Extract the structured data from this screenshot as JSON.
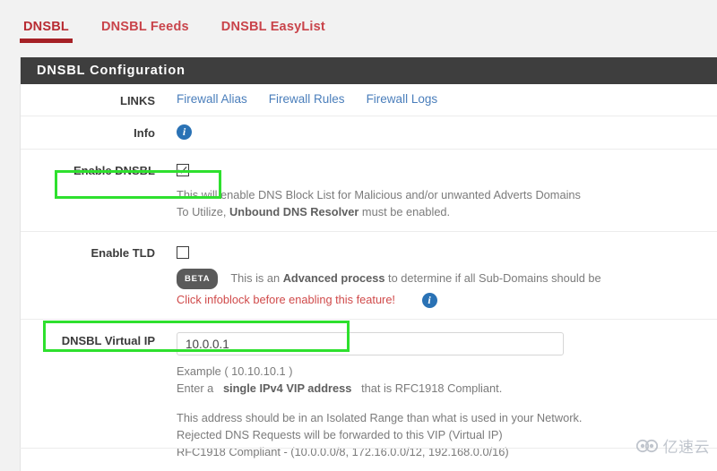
{
  "tabs": [
    {
      "label": "DNSBL",
      "active": true
    },
    {
      "label": "DNSBL Feeds",
      "active": false
    },
    {
      "label": "DNSBL EasyList",
      "active": false
    }
  ],
  "panel": {
    "title": "DNSBL Configuration"
  },
  "rows": {
    "links": {
      "label": "LINKS",
      "items": [
        {
          "label": "Firewall Alias"
        },
        {
          "label": "Firewall Rules"
        },
        {
          "label": "Firewall Logs"
        }
      ]
    },
    "info": {
      "label": "Info",
      "icon": "info-circle-icon"
    },
    "enable_dnsbl": {
      "label": "Enable DNSBL",
      "checked": true,
      "help_line1_a": "This will enable DNS Block List for Malicious and/or unwanted Adverts Domains",
      "help_line2_a": "To Utilize, ",
      "help_line2_b": "Unbound DNS Resolver",
      "help_line2_c": " must be enabled."
    },
    "enable_tld": {
      "label": "Enable TLD",
      "checked": false,
      "badge": "BETA",
      "help_a": "This is an ",
      "help_b": "Advanced process",
      "help_c": " to determine if all Sub-Domains should be",
      "warning": "Click infoblock before enabling this feature!",
      "icon": "info-circle-icon"
    },
    "virtual_ip": {
      "label": "DNSBL Virtual IP",
      "value": "10.0.0.1",
      "placeholder": "",
      "help_example": "Example ( 10.10.10.1 )",
      "help_enter_a": "Enter a",
      "help_enter_b": "single IPv4 VIP address",
      "help_enter_c": "that is RFC1918 Compliant.",
      "help_note1": "This address should be in an Isolated Range than what is used in your Network.",
      "help_note2": "Rejected DNS Requests will be forwarded to this VIP (Virtual IP)",
      "help_note3": "RFC1918 Compliant - (10.0.0.0/8, 172.16.0.0/12, 192.168.0.0/16)"
    }
  },
  "annotations": [
    {
      "name": "enable-dnsbl-highlight",
      "color": "#2ee02e"
    },
    {
      "name": "virtual-ip-highlight",
      "color": "#2ee02e"
    }
  ],
  "watermark": {
    "text": "亿速云"
  },
  "colors": {
    "tab_active": "#a62126",
    "tab_text": "#c9444b",
    "panel_header_bg": "#3e3e3e",
    "link": "#4a7ebb",
    "warning": "#d04a4a",
    "info_icon": "#2a72b5",
    "highlight": "#2ee02e"
  }
}
